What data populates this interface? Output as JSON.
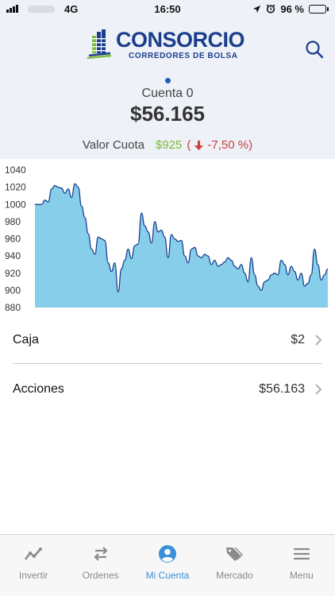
{
  "status_bar": {
    "network": "4G",
    "time": "16:50",
    "battery": "96 %",
    "battery_level": 0.96
  },
  "brand": {
    "name": "CONSORCIO",
    "tagline": "CORREDORES DE BOLSA"
  },
  "account": {
    "name": "Cuenta 0",
    "value": "$56.165"
  },
  "quota": {
    "label": "Valor Cuota",
    "value": "$925",
    "open_paren": "(",
    "change": "-7,50 %)"
  },
  "chart_data": {
    "type": "area",
    "y_ticks": [
      "1040",
      "1020",
      "1000",
      "980",
      "960",
      "940",
      "920",
      "900",
      "880"
    ],
    "ylim": [
      880,
      1040
    ],
    "grid": false,
    "values": [
      1000,
      1000,
      1000,
      1005,
      1003,
      1018,
      1022,
      1020,
      1019,
      1013,
      1018,
      1008,
      1024,
      1020,
      998,
      985,
      966,
      948,
      942,
      962,
      960,
      958,
      932,
      922,
      932,
      898,
      925,
      935,
      948,
      937,
      952,
      954,
      990,
      975,
      968,
      955,
      980,
      968,
      970,
      962,
      938,
      965,
      960,
      957,
      958,
      940,
      932,
      948,
      950,
      940,
      938,
      942,
      940,
      930,
      935,
      928,
      930,
      933,
      938,
      935,
      928,
      925,
      930,
      920,
      910,
      938,
      918,
      905,
      900,
      910,
      912,
      918,
      920,
      918,
      935,
      930,
      918,
      928,
      922,
      912,
      920,
      905,
      908,
      918,
      948,
      930,
      912,
      918,
      925
    ],
    "fill_color": "#87ceeb",
    "line_color": "#1b3f8f"
  },
  "portfolio": [
    {
      "label": "Caja",
      "value": "$2"
    },
    {
      "label": "Acciones",
      "value": "$56.163"
    }
  ],
  "tabs": [
    {
      "label": "Invertir",
      "icon": "chart-line-icon"
    },
    {
      "label": "Ordenes",
      "icon": "swap-arrows-icon"
    },
    {
      "label": "Mi Cuenta",
      "icon": "user-circle-icon",
      "active": true
    },
    {
      "label": "Mercado",
      "icon": "tags-icon"
    },
    {
      "label": "Menu",
      "icon": "hamburger-icon"
    }
  ],
  "colors": {
    "brand": "#1a3e8c",
    "header_bg": "#eef1f7",
    "positive": "#7cbb35",
    "negative": "#c9423e",
    "tab_active": "#3a8fd8",
    "tab_inactive": "#8a8a8a"
  }
}
